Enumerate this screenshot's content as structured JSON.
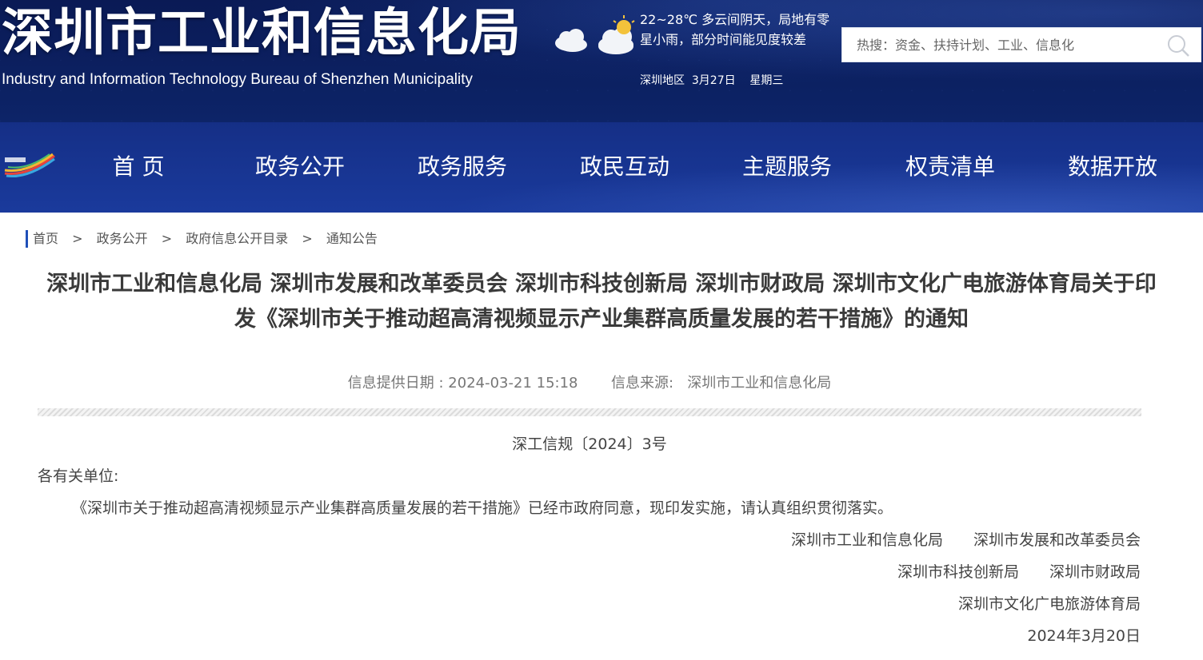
{
  "header": {
    "title_cn": "深圳市工业和信息化局",
    "title_en": "Industry and Information Technology Bureau of Shenzhen Municipality",
    "weather": {
      "text": "22~28℃ 多云间阴天，局地有零星小雨，部分时间能见度较差",
      "region_date": "深圳地区  3月27日    星期三"
    },
    "search": {
      "placeholder": "热搜：资金、扶持计划、工业、信息化"
    }
  },
  "nav": {
    "items": [
      "首 页",
      "政务公开",
      "政务服务",
      "政民互动",
      "主题服务",
      "权责清单",
      "数据开放"
    ]
  },
  "breadcrumb": {
    "items": [
      "首页",
      "政务公开",
      "政府信息公开目录",
      "通知公告"
    ],
    "separator": ">"
  },
  "article": {
    "title": "深圳市工业和信息化局 深圳市发展和改革委员会 深圳市科技创新局 深圳市财政局 深圳市文化广电旅游体育局关于印发《深圳市关于推动超高清视频显示产业集群高质量发展的若干措施》的通知",
    "date_label": "信息提供日期 : 2024-03-21 15:18",
    "source_label": "信息来源:   深圳市工业和信息化局",
    "doc_number": "深工信规〔2024〕3号",
    "salutation": "各有关单位:",
    "body": "《深圳市关于推动超高清视频显示产业集群高质量发展的若干措施》已经市政府同意，现印发实施，请认真组织贯彻落实。",
    "signatories": [
      [
        "深圳市工业和信息化局",
        "深圳市发展和改革委员会"
      ],
      [
        "深圳市科技创新局",
        "深圳市财政局"
      ],
      [
        "深圳市文化广电旅游体育局"
      ]
    ],
    "sign_date": "2024年3月20日"
  }
}
